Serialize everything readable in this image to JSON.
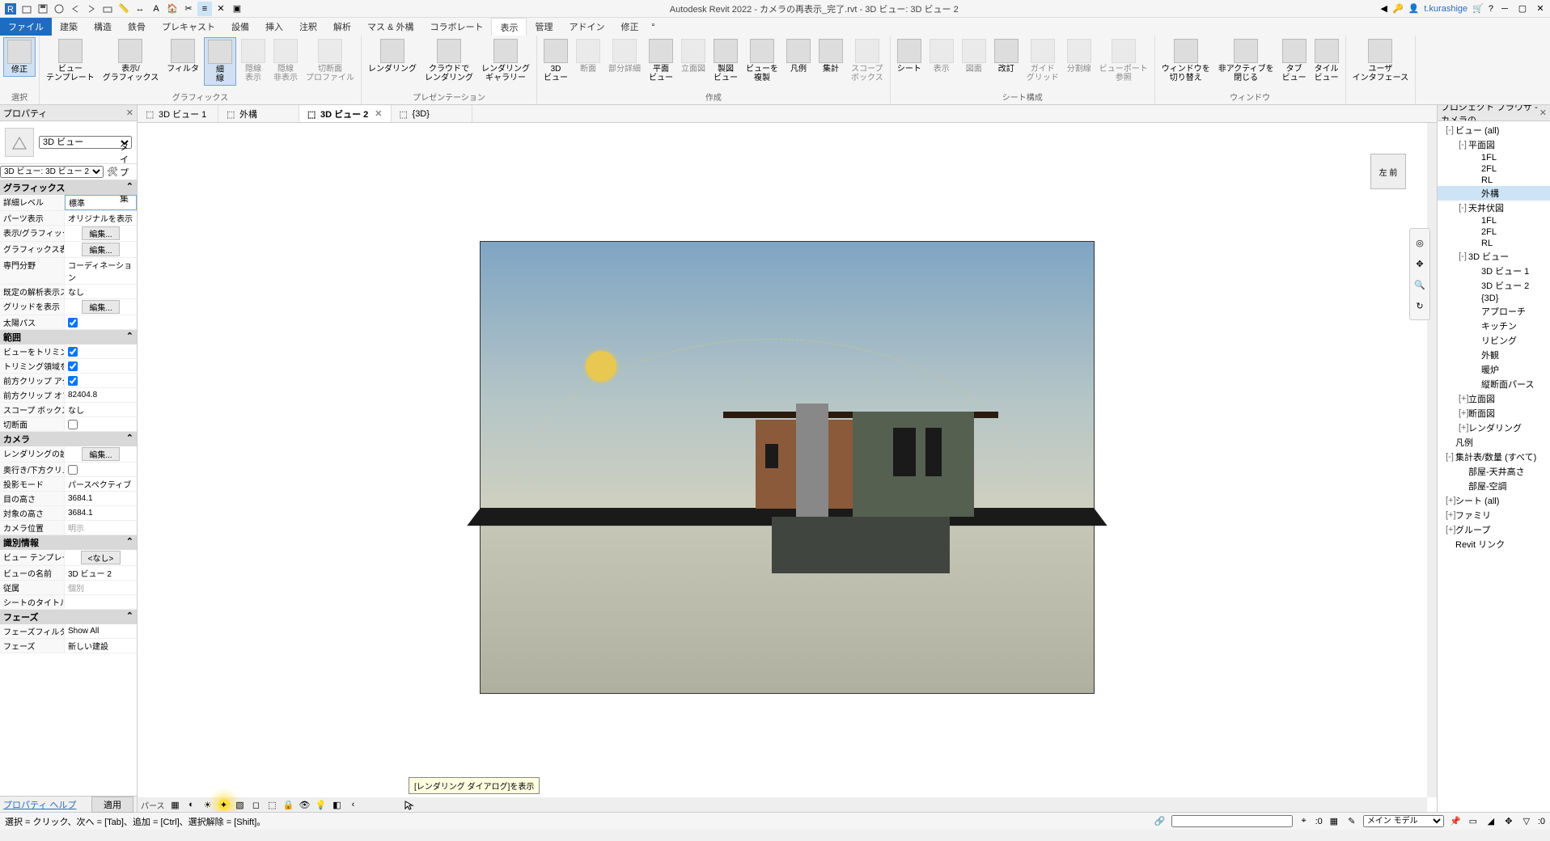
{
  "app": {
    "title": "Autodesk Revit 2022 - カメラの再表示_完了.rvt - 3D ビュー: 3D ビュー 2",
    "user": "t.kurashige"
  },
  "tabs": {
    "file": "ファイル",
    "items": [
      "建築",
      "構造",
      "鉄骨",
      "プレキャスト",
      "設備",
      "挿入",
      "注釈",
      "解析",
      "マス & 外構",
      "コラボレート",
      "表示",
      "管理",
      "アドイン",
      "修正"
    ],
    "active": "表示"
  },
  "ribbon": {
    "panels": [
      {
        "label": "選択",
        "buttons": [
          {
            "t": "修正",
            "big": true,
            "sel": true
          }
        ]
      },
      {
        "label": "グラフィックス",
        "buttons": [
          {
            "t": "ビュー\nテンプレート",
            "big": true
          },
          {
            "t": "表示/\nグラフィックス",
            "big": true
          },
          {
            "t": "フィルタ",
            "big": true
          },
          {
            "t": "細\n線",
            "big": true,
            "sel": true
          },
          {
            "t": "隠線\n表示",
            "big": true,
            "dis": true
          },
          {
            "t": "隠線\n非表示",
            "big": true,
            "dis": true
          },
          {
            "t": "切断面\nプロファイル",
            "big": true,
            "dis": true
          }
        ]
      },
      {
        "label": "プレゼンテーション",
        "buttons": [
          {
            "t": "レンダリング",
            "big": true
          },
          {
            "t": "クラウドで\nレンダリング",
            "big": true
          },
          {
            "t": "レンダリング\nギャラリー",
            "big": true
          }
        ]
      },
      {
        "label": "作成",
        "buttons": [
          {
            "t": "3D\nビュー",
            "big": true
          },
          {
            "t": "断面",
            "big": true,
            "dis": true
          },
          {
            "t": "部分詳細",
            "big": true,
            "dis": true
          },
          {
            "t": "平面\nビュー",
            "big": true
          },
          {
            "t": "立面図",
            "big": true,
            "dis": true
          },
          {
            "t": "製図\nビュー",
            "big": true
          },
          {
            "t": "ビューを\n複製",
            "big": true
          },
          {
            "t": "凡例",
            "big": true
          },
          {
            "t": "集計",
            "big": true
          },
          {
            "t": "スコープ\nボックス",
            "big": true,
            "dis": true
          }
        ]
      },
      {
        "label": "シート構成",
        "buttons": [
          {
            "t": "シート",
            "big": true
          },
          {
            "t": "表示",
            "big": true,
            "dis": true
          },
          {
            "t": "図面",
            "big": true,
            "dis": true
          },
          {
            "t": "改訂",
            "big": true
          },
          {
            "t": "ガイド\nグリッド",
            "big": true,
            "dis": true
          },
          {
            "t": "分割線",
            "big": true,
            "dis": true
          },
          {
            "t": "ビューポート\n参照",
            "big": true,
            "dis": true
          }
        ]
      },
      {
        "label": "ウィンドウ",
        "buttons": [
          {
            "t": "ウィンドウを\n切り替え",
            "big": true
          },
          {
            "t": "非アクティブを\n閉じる",
            "big": true
          },
          {
            "t": "タブ\nビュー",
            "big": true
          },
          {
            "t": "タイル\nビュー",
            "big": true
          }
        ]
      },
      {
        "label": "",
        "buttons": [
          {
            "t": "ユーザ\nインタフェース",
            "big": true
          }
        ]
      }
    ]
  },
  "viewtabs": [
    {
      "label": "3D ビュー 1",
      "active": false
    },
    {
      "label": "外構",
      "active": false
    },
    {
      "label": "3D ビュー 2",
      "active": true
    },
    {
      "label": "{3D}",
      "active": false
    }
  ],
  "properties": {
    "title": "プロパティ",
    "type_label": "3D ビュー",
    "filter": "3D ビュー: 3D ビュー 2",
    "typeedit": "タイプ編集",
    "groups": [
      {
        "name": "グラフィックス",
        "rows": [
          {
            "n": "詳細レベル",
            "v": "標準",
            "kind": "select"
          },
          {
            "n": "パーツ表示",
            "v": "オリジナルを表示"
          },
          {
            "n": "表示/グラフィック...",
            "v": "編集...",
            "kind": "btn"
          },
          {
            "n": "グラフィックス表示...",
            "v": "編集...",
            "kind": "btn"
          },
          {
            "n": "専門分野",
            "v": "コーディネーション"
          },
          {
            "n": "既定の解析表示ス...",
            "v": "なし"
          },
          {
            "n": "グリッドを表示",
            "v": "編集...",
            "kind": "btn"
          },
          {
            "n": "太陽パス",
            "v": "true",
            "kind": "check"
          }
        ]
      },
      {
        "name": "範囲",
        "rows": [
          {
            "n": "ビューをトリミング",
            "v": "true",
            "kind": "check"
          },
          {
            "n": "トリミング領域を表...",
            "v": "true",
            "kind": "check"
          },
          {
            "n": "前方クリップ アク...",
            "v": "true",
            "kind": "check"
          },
          {
            "n": "前方クリップ オフ...",
            "v": "82404.8"
          },
          {
            "n": "スコープ ボックス",
            "v": "なし"
          },
          {
            "n": "切断面",
            "v": "false",
            "kind": "check"
          }
        ]
      },
      {
        "name": "カメラ",
        "rows": [
          {
            "n": "レンダリングの設定",
            "v": "編集...",
            "kind": "btn"
          },
          {
            "n": "奥行き/下方クリ...",
            "v": "false",
            "kind": "check",
            "dis": true
          },
          {
            "n": "投影モード",
            "v": "パースペクティブ"
          },
          {
            "n": "目の高さ",
            "v": "3684.1"
          },
          {
            "n": "対象の高さ",
            "v": "3684.1"
          },
          {
            "n": "カメラ位置",
            "v": "明示",
            "dis": true
          }
        ]
      },
      {
        "name": "識別情報",
        "rows": [
          {
            "n": "ビュー テンプレート",
            "v": "<なし>",
            "kind": "btnc"
          },
          {
            "n": "ビューの名前",
            "v": "3D ビュー 2"
          },
          {
            "n": "従属",
            "v": "個別",
            "dis": true
          },
          {
            "n": "シートのタイトル",
            "v": ""
          }
        ]
      },
      {
        "name": "フェーズ",
        "rows": [
          {
            "n": "フェーズフィルタ",
            "v": "Show All"
          },
          {
            "n": "フェーズ",
            "v": "新しい建設"
          }
        ]
      }
    ],
    "help": "プロパティ ヘルプ",
    "apply": "適用"
  },
  "browser": {
    "title": "プロジェクト ブラウザ - カメラの...",
    "tree": [
      {
        "l": 0,
        "t": "ビュー (all)",
        "exp": "-"
      },
      {
        "l": 1,
        "t": "平面図",
        "exp": "-"
      },
      {
        "l": 2,
        "t": "1FL"
      },
      {
        "l": 2,
        "t": "2FL"
      },
      {
        "l": 2,
        "t": "RL"
      },
      {
        "l": 2,
        "t": "外構",
        "sel": true
      },
      {
        "l": 1,
        "t": "天井伏図",
        "exp": "-"
      },
      {
        "l": 2,
        "t": "1FL"
      },
      {
        "l": 2,
        "t": "2FL"
      },
      {
        "l": 2,
        "t": "RL"
      },
      {
        "l": 1,
        "t": "3D ビュー",
        "exp": "-"
      },
      {
        "l": 2,
        "t": "3D ビュー 1"
      },
      {
        "l": 2,
        "t": "3D ビュー 2"
      },
      {
        "l": 2,
        "t": "{3D}"
      },
      {
        "l": 2,
        "t": "アプローチ"
      },
      {
        "l": 2,
        "t": "キッチン"
      },
      {
        "l": 2,
        "t": "リビング"
      },
      {
        "l": 2,
        "t": "外観"
      },
      {
        "l": 2,
        "t": "暖炉"
      },
      {
        "l": 2,
        "t": "縦断面パース"
      },
      {
        "l": 1,
        "t": "立面図",
        "exp": "+"
      },
      {
        "l": 1,
        "t": "断面図",
        "exp": "+"
      },
      {
        "l": 1,
        "t": "レンダリング",
        "exp": "+"
      },
      {
        "l": 0,
        "t": "凡例"
      },
      {
        "l": 0,
        "t": "集計表/数量 (すべて)",
        "exp": "-"
      },
      {
        "l": 1,
        "t": "部屋-天井高さ"
      },
      {
        "l": 1,
        "t": "部屋-空調"
      },
      {
        "l": 0,
        "t": "シート (all)",
        "exp": "+"
      },
      {
        "l": 0,
        "t": "ファミリ",
        "exp": "+"
      },
      {
        "l": 0,
        "t": "グループ",
        "exp": "+"
      },
      {
        "l": 0,
        "t": "Revit リンク"
      }
    ]
  },
  "viewcontrol": {
    "mode": "パース",
    "tooltip": "[レンダリング ダイアログ]を表示"
  },
  "viewcube": {
    "face": "左 前"
  },
  "status": {
    "hint": "選択 = クリック、次へ = [Tab]、追加 = [Ctrl]、選択解除 = [Shift]。",
    "scale": ":0",
    "model": "メイン モデル",
    "filter_count": ":0"
  }
}
